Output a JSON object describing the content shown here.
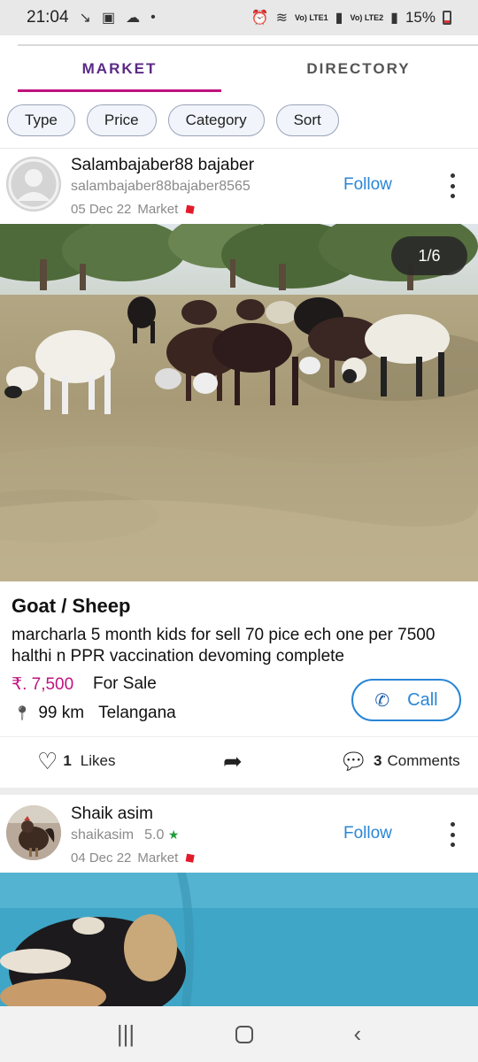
{
  "status_bar": {
    "time": "21:04",
    "battery": "15%",
    "sim1": "Vo) LTE1",
    "sim2": "Vo) LTE2"
  },
  "tabs": [
    {
      "label": "MARKET",
      "active": true
    },
    {
      "label": "DIRECTORY",
      "active": false
    }
  ],
  "filters": [
    "Type",
    "Price",
    "Category",
    "Sort"
  ],
  "posts": [
    {
      "name": "Salambajaber88 bajaber",
      "handle": "salambajaber88bajaber8565",
      "date": "05 Dec 22",
      "section": "Market",
      "follow_label": "Follow",
      "image_counter": "1/6",
      "title": "Goat / Sheep",
      "description": "marcharla 5 month kids for sell 70 pice ech one per 7500 halthi n PPR vaccination devoming complete",
      "price": "₹. 7,500",
      "status": "For Sale",
      "distance": "99 km",
      "location": "Telangana",
      "call_label": "Call",
      "likes_count": "1",
      "likes_label": "Likes",
      "comments_count": "3",
      "comments_label": "Comments"
    },
    {
      "name": "Shaik asim",
      "handle": "shaikasim",
      "rating": "5.0",
      "date": "04 Dec 22",
      "section": "Market",
      "follow_label": "Follow"
    }
  ],
  "colors": {
    "accent_purple": "#5b2a86",
    "accent_magenta": "#c0127f",
    "link_blue": "#2a86d6",
    "tag_red": "#e21b2a"
  },
  "icons": [
    "wifi-icon",
    "tag-icon",
    "location-pin-icon",
    "phone-icon",
    "heart-icon",
    "share-icon",
    "comment-icon",
    "more-icon"
  ]
}
